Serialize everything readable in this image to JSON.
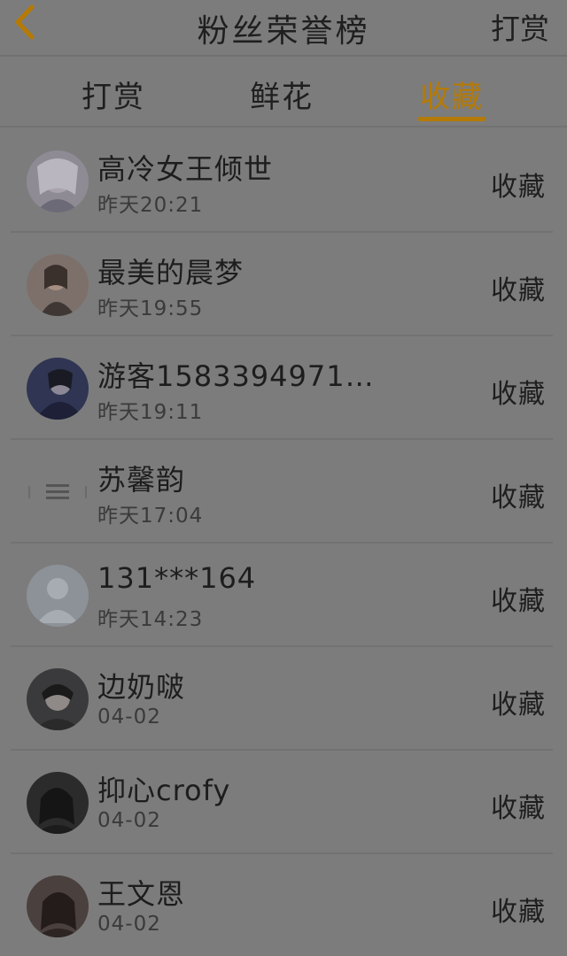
{
  "header": {
    "title": "粉丝荣誉榜",
    "action": "打赏"
  },
  "tabs": [
    {
      "label": "打赏"
    },
    {
      "label": "鲜花"
    },
    {
      "label": "收藏"
    }
  ],
  "active_tab": "收藏",
  "colors": {
    "accent": "#b57a06",
    "background": "#7c7c7c",
    "divider": "#727272"
  },
  "list": [
    {
      "name": "高冷女王倾世",
      "time": "昨天20:21",
      "action": "收藏"
    },
    {
      "name": "最美的晨梦",
      "time": "昨天19:55",
      "action": "收藏"
    },
    {
      "name": "游客1583394971…",
      "time": "昨天19:11",
      "action": "收藏"
    },
    {
      "name": "苏馨韵",
      "time": "昨天17:04",
      "action": "收藏"
    },
    {
      "name": "131***164",
      "time": "昨天14:23",
      "action": "收藏"
    },
    {
      "name": "边奶啵",
      "time": "04-02",
      "action": "收藏"
    },
    {
      "name": "抑心crofy",
      "time": "04-02",
      "action": "收藏"
    },
    {
      "name": "王文恩",
      "time": "04-02",
      "action": "收藏"
    }
  ]
}
